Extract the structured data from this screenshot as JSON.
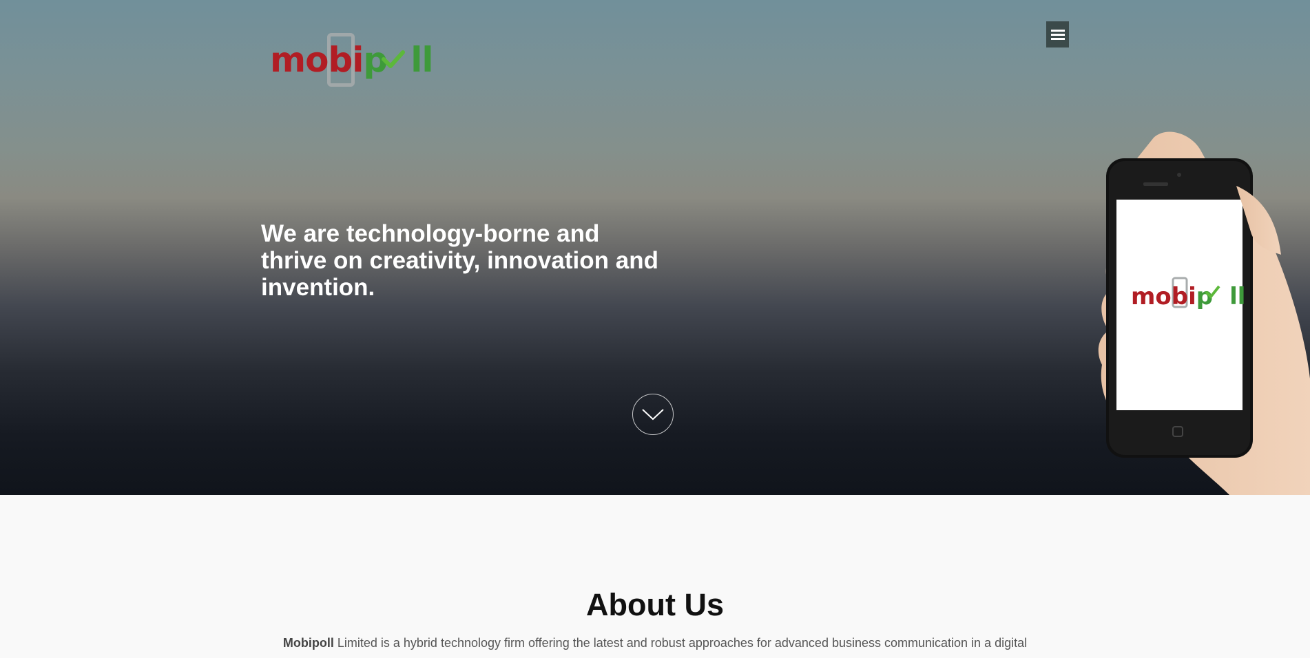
{
  "header": {
    "logo": {
      "part1": "mob",
      "part2": "i",
      "part3": "p",
      "part4": "ll",
      "brand_red": "#b11d24",
      "brand_green": "#3e9a3a"
    },
    "menu_icon": "hamburger-menu-icon"
  },
  "hero": {
    "heading": "We are technology-borne and thrive on creativity, innovation and invention.",
    "scroll_icon": "chevron-down-icon",
    "phone_screen_logo": {
      "part1": "mob",
      "part2": "i",
      "part3": "p",
      "part4": "ll"
    }
  },
  "about": {
    "title": "About Us",
    "company_name": "Mobipoll",
    "description": "Limited is a hybrid technology firm offering the latest and robust approaches for advanced business communication in a digital"
  },
  "colors": {
    "menu_bg": "#3b4a4a",
    "section_bg": "#f9f9f9"
  }
}
